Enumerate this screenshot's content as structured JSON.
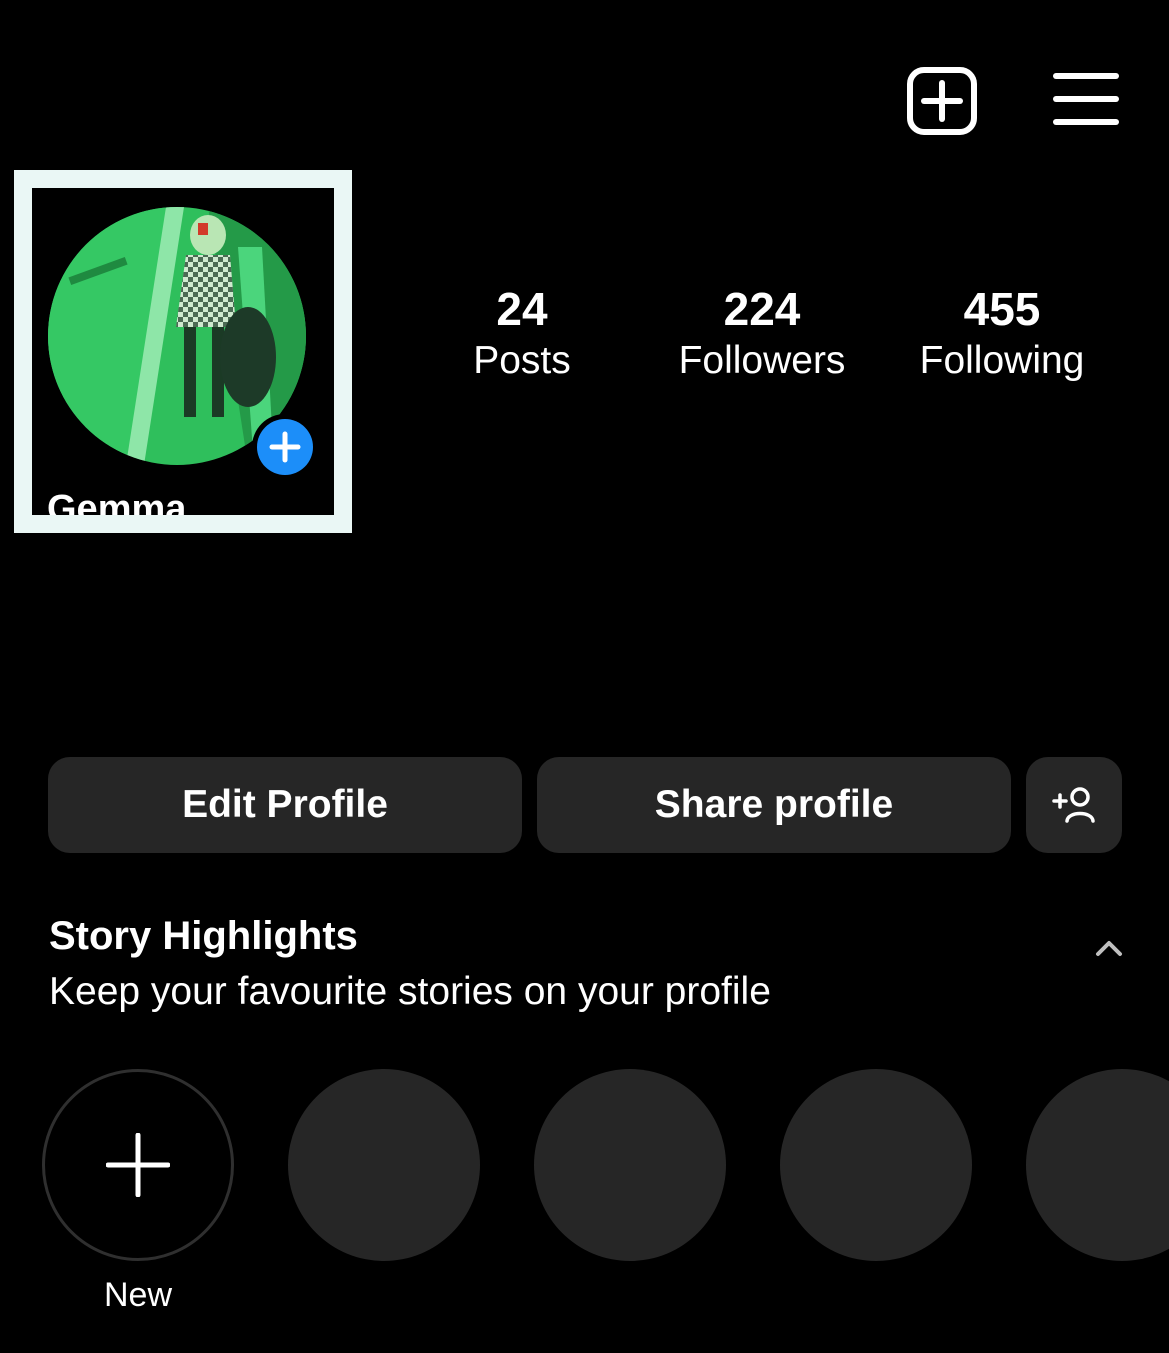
{
  "header": {
    "icons": [
      "create-post-icon",
      "menu-icon"
    ]
  },
  "profile": {
    "display_name": "Gemma",
    "stats": [
      {
        "value": "24",
        "label": "Posts"
      },
      {
        "value": "224",
        "label": "Followers"
      },
      {
        "value": "455",
        "label": "Following"
      }
    ]
  },
  "actions": {
    "edit_label": "Edit Profile",
    "share_label": "Share profile",
    "add_user_icon": "add-person-icon"
  },
  "highlights": {
    "title": "Story Highlights",
    "subtitle": "Keep your favourite stories on your profile",
    "new_label": "New"
  },
  "colors": {
    "background": "#000000",
    "button": "#262626",
    "accent": "#1c8ef9",
    "frame": "#eaf7f5"
  }
}
